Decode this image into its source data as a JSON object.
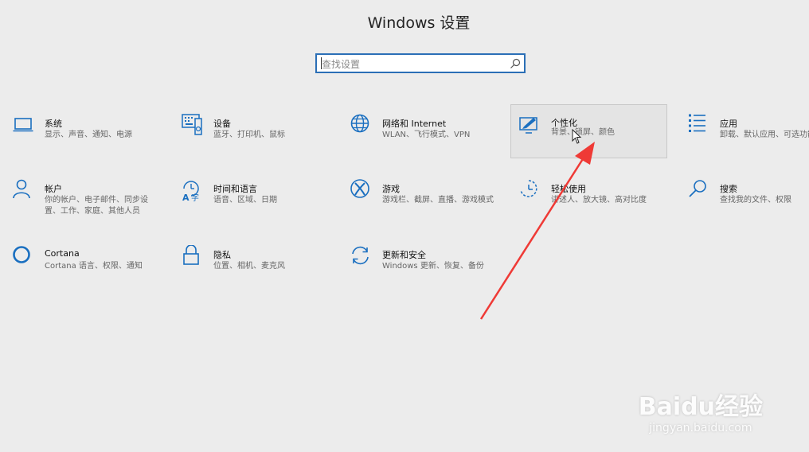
{
  "window": {
    "title": "Windows 设置"
  },
  "search": {
    "placeholder": "查找设置"
  },
  "accent": "#1a6fc0",
  "tiles": [
    {
      "name": "系统",
      "desc": "显示、声音、通知、电源",
      "icon": "laptop-icon"
    },
    {
      "name": "设备",
      "desc": "蓝牙、打印机、鼠标",
      "icon": "keyboard-icon"
    },
    {
      "name": "网络和 Internet",
      "desc": "WLAN、飞行模式、VPN",
      "icon": "globe-icon"
    },
    {
      "name": "个性化",
      "desc": "背景、锁屏、颜色",
      "icon": "paint-icon"
    },
    {
      "name": "应用",
      "desc": "卸载、默认应用、可选功能",
      "icon": "list-icon"
    },
    {
      "name": "帐户",
      "desc": "你的帐户、电子邮件、同步设置、工作、家庭、其他人员",
      "icon": "person-icon"
    },
    {
      "name": "时间和语言",
      "desc": "语音、区域、日期",
      "icon": "time-language-icon"
    },
    {
      "name": "游戏",
      "desc": "游戏栏、截屏、直播、游戏模式",
      "icon": "xbox-icon"
    },
    {
      "name": "轻松使用",
      "desc": "讲述人、放大镜、高对比度",
      "icon": "ease-of-access-icon"
    },
    {
      "name": "搜索",
      "desc": "查找我的文件、权限",
      "icon": "search-icon"
    },
    {
      "name": "Cortana",
      "desc": "Cortana 语言、权限、通知",
      "icon": "cortana-icon"
    },
    {
      "name": "隐私",
      "desc": "位置、相机、麦克风",
      "icon": "lock-icon"
    },
    {
      "name": "更新和安全",
      "desc": "Windows 更新、恢复、备份",
      "icon": "sync-icon"
    }
  ],
  "watermark": {
    "main": "Baidu经验",
    "sub": "jingyan.baidu.com"
  }
}
